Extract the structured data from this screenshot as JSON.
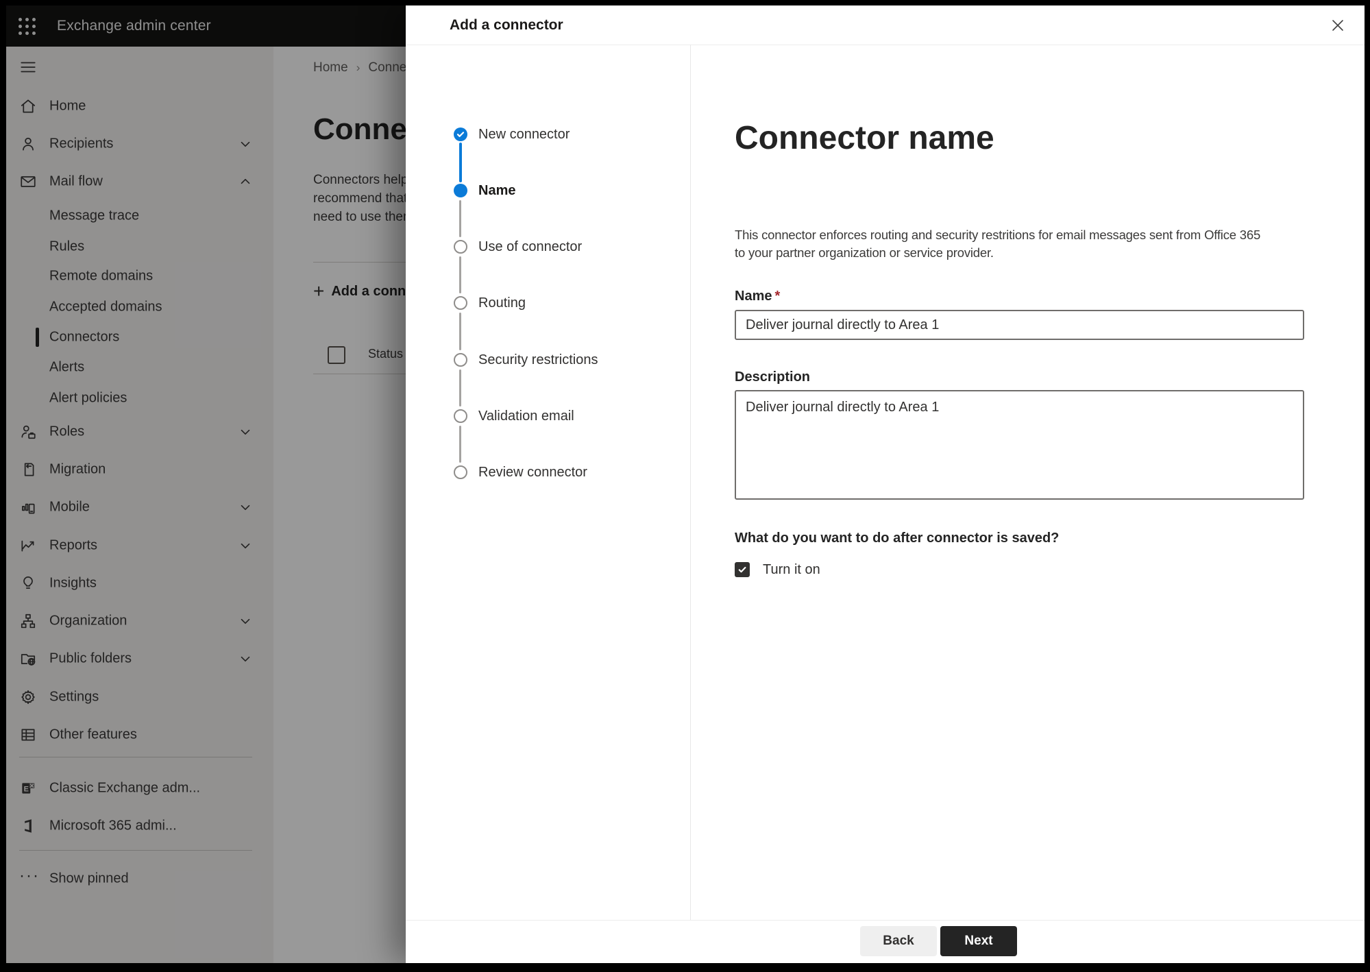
{
  "colors": {
    "accent": "#0b7bd8",
    "dark_button": "#242424",
    "required_mark_color": "#a4262c"
  },
  "topbar": {
    "title": "Exchange admin center"
  },
  "sidebar": {
    "items": [
      {
        "label": "Home",
        "icon": "home-icon"
      },
      {
        "label": "Recipients",
        "icon": "person-icon",
        "chevron": "down"
      },
      {
        "label": "Mail flow",
        "icon": "mail-icon",
        "chevron": "up",
        "expanded": true
      },
      {
        "label": "Message trace",
        "sub": true
      },
      {
        "label": "Rules",
        "sub": true
      },
      {
        "label": "Remote domains",
        "sub": true
      },
      {
        "label": "Accepted domains",
        "sub": true
      },
      {
        "label": "Connectors",
        "sub": true,
        "selected": true
      },
      {
        "label": "Alerts",
        "sub": true
      },
      {
        "label": "Alert policies",
        "sub": true
      },
      {
        "label": "Roles",
        "icon": "roles-icon",
        "chevron": "down"
      },
      {
        "label": "Migration",
        "icon": "migration-icon"
      },
      {
        "label": "Mobile",
        "icon": "mobile-icon",
        "chevron": "down"
      },
      {
        "label": "Reports",
        "icon": "reports-icon",
        "chevron": "down"
      },
      {
        "label": "Insights",
        "icon": "lightbulb-icon"
      },
      {
        "label": "Organization",
        "icon": "org-tree-icon",
        "chevron": "down"
      },
      {
        "label": "Public folders",
        "icon": "folder-globe-icon",
        "chevron": "down"
      },
      {
        "label": "Settings",
        "icon": "gear-icon"
      },
      {
        "label": "Other features",
        "icon": "table-icon"
      },
      {
        "label": "Classic Exchange adm...",
        "icon": "classic-exchange-icon"
      },
      {
        "label": "Microsoft 365 admi...",
        "icon": "microsoft-365-icon"
      },
      {
        "label": "Show pinned",
        "icon": "ellipsis-icon"
      }
    ]
  },
  "page": {
    "breadcrumb": {
      "home": "Home",
      "current": "Connectors"
    },
    "title": "Connectors",
    "intro_lines": [
      "Connectors help route email messages",
      "recommend that you check to see if you",
      "need to use them before creating one."
    ],
    "add_button_label": "Add a connector",
    "table": {
      "first_column": "Status"
    }
  },
  "modal": {
    "title": "Add a connector",
    "steps": [
      {
        "label": "New connector",
        "state": "complete"
      },
      {
        "label": "Name",
        "state": "current"
      },
      {
        "label": "Use of connector",
        "state": "upcoming"
      },
      {
        "label": "Routing",
        "state": "upcoming"
      },
      {
        "label": "Security restrictions",
        "state": "upcoming"
      },
      {
        "label": "Validation email",
        "state": "upcoming"
      },
      {
        "label": "Review connector",
        "state": "upcoming"
      }
    ],
    "content": {
      "heading": "Connector name",
      "description_lines": [
        "This connector enforces routing and security restritions for email messages sent from Office 365",
        "to your partner organization or service provider."
      ],
      "name_label": "Name",
      "required_mark": "*",
      "name_value": "Deliver journal directly to Area 1",
      "description_label": "Description",
      "description_value": "Deliver journal directly to Area 1",
      "after_save_question": "What do you want to do after connector is saved?",
      "turn_on_label": "Turn it on",
      "turn_on_checked": true
    },
    "footer": {
      "back_label": "Back",
      "next_label": "Next"
    }
  }
}
